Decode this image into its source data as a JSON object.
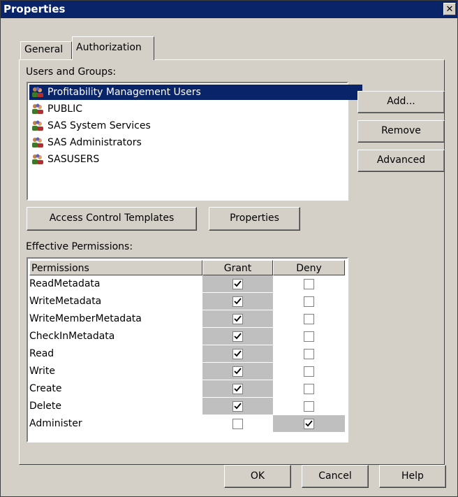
{
  "window": {
    "title": "Properties",
    "close_glyph": "✕"
  },
  "tabs": [
    {
      "label": "General",
      "active": false
    },
    {
      "label": "Authorization",
      "active": true
    }
  ],
  "users_section": {
    "label": "Users and Groups:",
    "items": [
      {
        "name": "Profitability Management Users",
        "selected": true,
        "icon": "user-group-icon"
      },
      {
        "name": "PUBLIC",
        "selected": false,
        "icon": "user-group-icon"
      },
      {
        "name": "SAS System Services",
        "selected": false,
        "icon": "user-group-icon"
      },
      {
        "name": "SAS Administrators",
        "selected": false,
        "icon": "user-group-icon"
      },
      {
        "name": "SASUSERS",
        "selected": false,
        "icon": "user-group-icon"
      }
    ]
  },
  "side_buttons": {
    "add": "Add...",
    "remove": "Remove",
    "advanced": "Advanced"
  },
  "mid_buttons": {
    "access_control_templates": "Access Control Templates",
    "properties": "Properties"
  },
  "permissions_section": {
    "label": "Effective Permissions:",
    "columns": [
      "Permissions",
      "Grant",
      "Deny"
    ],
    "rows": [
      {
        "name": "ReadMetadata",
        "grant": true,
        "deny": false
      },
      {
        "name": "WriteMetadata",
        "grant": true,
        "deny": false
      },
      {
        "name": "WriteMemberMetadata",
        "grant": true,
        "deny": false
      },
      {
        "name": "CheckInMetadata",
        "grant": true,
        "deny": false
      },
      {
        "name": "Read",
        "grant": true,
        "deny": false
      },
      {
        "name": "Write",
        "grant": true,
        "deny": false
      },
      {
        "name": "Create",
        "grant": true,
        "deny": false
      },
      {
        "name": "Delete",
        "grant": true,
        "deny": false
      },
      {
        "name": "Administer",
        "grant": false,
        "deny": true
      }
    ]
  },
  "footer_buttons": {
    "ok": "OK",
    "cancel": "Cancel",
    "help": "Help"
  },
  "colors": {
    "dialog_face": "#d4d0c8",
    "title_bar": "#0a246a",
    "selection": "#0a246a",
    "shaded_cell": "#bfbfbf"
  }
}
